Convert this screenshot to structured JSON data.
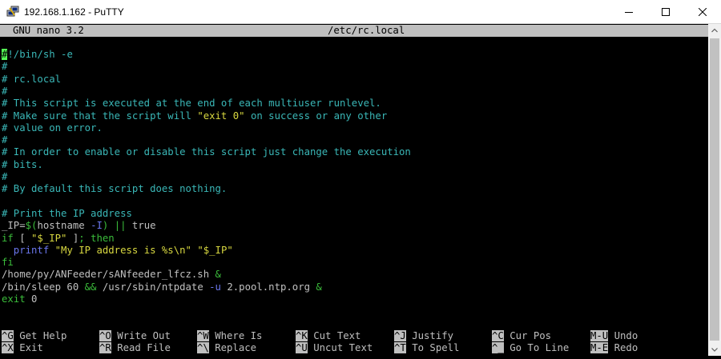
{
  "window": {
    "title": "192.168.1.162 - PuTTY",
    "icon": "putty-icon",
    "controls": [
      "minimize-icon",
      "maximize-icon",
      "close-icon"
    ]
  },
  "nano": {
    "app_version": "GNU nano 3.2",
    "filename": "/etc/rc.local"
  },
  "file_lines": [
    [
      {
        "t": "#",
        "c": "cursor"
      },
      {
        "t": "!/bin/sh -e",
        "c": "cyan"
      }
    ],
    [
      {
        "t": "#",
        "c": "cyan"
      }
    ],
    [
      {
        "t": "# rc.local",
        "c": "cyan"
      }
    ],
    [
      {
        "t": "#",
        "c": "cyan"
      }
    ],
    [
      {
        "t": "# This script is executed at the end of each multiuser runlevel.",
        "c": "cyan"
      }
    ],
    [
      {
        "t": "# Make sure that the script will ",
        "c": "cyan"
      },
      {
        "t": "\"exit 0\"",
        "c": "yellow"
      },
      {
        "t": " on success or any other",
        "c": "cyan"
      }
    ],
    [
      {
        "t": "# value on error.",
        "c": "cyan"
      }
    ],
    [
      {
        "t": "#",
        "c": "cyan"
      }
    ],
    [
      {
        "t": "# In order to enable or disable this script just change the execution",
        "c": "cyan"
      }
    ],
    [
      {
        "t": "# bits.",
        "c": "cyan"
      }
    ],
    [
      {
        "t": "#",
        "c": "cyan"
      }
    ],
    [
      {
        "t": "# By default this script does nothing.",
        "c": "cyan"
      }
    ],
    [],
    [
      {
        "t": "# Print the IP address",
        "c": "cyan"
      }
    ],
    [
      {
        "t": "_IP=",
        "c": "white"
      },
      {
        "t": "$(",
        "c": "green"
      },
      {
        "t": "hostname ",
        "c": "white"
      },
      {
        "t": "-I",
        "c": "blue"
      },
      {
        "t": ")",
        "c": "green"
      },
      {
        "t": " ",
        "c": "white"
      },
      {
        "t": "||",
        "c": "green"
      },
      {
        "t": " true",
        "c": "white"
      }
    ],
    [
      {
        "t": "if",
        "c": "green"
      },
      {
        "t": " [ ",
        "c": "white"
      },
      {
        "t": "\"$_IP\"",
        "c": "yellow"
      },
      {
        "t": " ]",
        "c": "white"
      },
      {
        "t": "; then",
        "c": "green"
      }
    ],
    [
      {
        "t": "  printf",
        "c": "blue"
      },
      {
        "t": " ",
        "c": "white"
      },
      {
        "t": "\"My IP address is %s\\n\"",
        "c": "yellow"
      },
      {
        "t": " ",
        "c": "white"
      },
      {
        "t": "\"$_IP\"",
        "c": "yellow"
      }
    ],
    [
      {
        "t": "fi",
        "c": "green"
      }
    ],
    [
      {
        "t": "/home/py/ANFeeder/sANfeeder_lfcz.sh ",
        "c": "white"
      },
      {
        "t": "&",
        "c": "green"
      }
    ],
    [
      {
        "t": "/bin/sleep 60 ",
        "c": "white"
      },
      {
        "t": "&&",
        "c": "green"
      },
      {
        "t": " /usr/sbin/ntpdate ",
        "c": "white"
      },
      {
        "t": "-u",
        "c": "blue"
      },
      {
        "t": " 2.pool.ntp.org ",
        "c": "white"
      },
      {
        "t": "&",
        "c": "green"
      }
    ],
    [
      {
        "t": "exit",
        "c": "green"
      },
      {
        "t": " 0",
        "c": "white"
      }
    ]
  ],
  "shortcuts": [
    [
      {
        "key": "^G",
        "label": "Get Help"
      },
      {
        "key": "^O",
        "label": "Write Out"
      },
      {
        "key": "^W",
        "label": "Where Is"
      },
      {
        "key": "^K",
        "label": "Cut Text"
      },
      {
        "key": "^J",
        "label": "Justify"
      },
      {
        "key": "^C",
        "label": "Cur Pos"
      },
      {
        "key": "M-U",
        "label": "Undo"
      }
    ],
    [
      {
        "key": "^X",
        "label": "Exit"
      },
      {
        "key": "^R",
        "label": "Read File"
      },
      {
        "key": "^\\",
        "label": "Replace"
      },
      {
        "key": "^U",
        "label": "Uncut Text"
      },
      {
        "key": "^T",
        "label": "To Spell"
      },
      {
        "key": "^_",
        "label": "Go To Line"
      },
      {
        "key": "M-E",
        "label": "Redo"
      }
    ]
  ],
  "colors": {
    "background": "#000000",
    "header_bg": "#bfbfbf",
    "comment": "#3ab7b7",
    "keyword": "#3bbd3b",
    "string": "#d8d840",
    "command": "#6b77ee",
    "cursor": "#55ff55"
  }
}
